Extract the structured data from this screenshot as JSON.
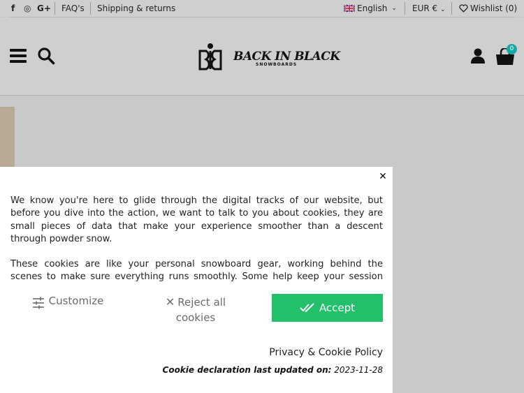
{
  "topbar": {
    "social": [
      "f",
      "◎",
      "G+"
    ],
    "faq": "FAQ's",
    "shipping": "Shipping & returns",
    "language": "English",
    "currency": "EUR €",
    "wishlist": "Wishlist (0)"
  },
  "header": {
    "logo_main": "BACK IN BLACK",
    "logo_sub": "SNOWBOARDS",
    "cart_count": "0"
  },
  "cookie_modal": {
    "paragraph_1": "We know you're here to glide through the digital tracks of our website, but before you dive into the action, we want to talk to you about cookies, they are small pieces of data that make your experience smoother than a descent through powder snow.",
    "paragraph_2": "These cookies are like your personal snowboard gear, working behind the scenes to make sure everything runs smoothly. Some help keep your session active,",
    "customize_label": "Customize",
    "reject_label": "Reject all cookies",
    "accept_label": "Accept",
    "policy_link": "Privacy & Cookie Policy",
    "updated_label": "Cookie declaration last updated on:",
    "updated_date": "2023-11-28"
  },
  "colors": {
    "accept": "#22c06a",
    "badge": "#16a9a3",
    "overlay": "#c9c9c9"
  }
}
